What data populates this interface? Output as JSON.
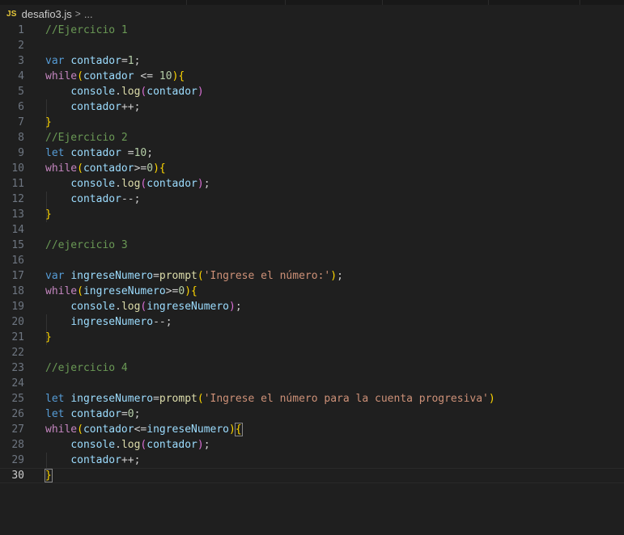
{
  "breadcrumb": {
    "icon_text": "JS",
    "file": "desafio3.js",
    "separator": ">",
    "ellipsis": "..."
  },
  "editor": {
    "current_line": 30,
    "lines": [
      {
        "n": "1",
        "tokens": [
          [
            "cm",
            "//Ejercicio 1"
          ]
        ]
      },
      {
        "n": "2",
        "tokens": []
      },
      {
        "n": "3",
        "tokens": [
          [
            "kw",
            "var"
          ],
          [
            "p",
            " "
          ],
          [
            "var",
            "contador"
          ],
          [
            "p",
            "="
          ],
          [
            "num-lit",
            "1"
          ],
          [
            "p",
            ";"
          ]
        ]
      },
      {
        "n": "4",
        "tokens": [
          [
            "ctl",
            "while"
          ],
          [
            "b1",
            "("
          ],
          [
            "var",
            "contador"
          ],
          [
            "p",
            " <= "
          ],
          [
            "num-lit",
            "10"
          ],
          [
            "b1",
            ")"
          ],
          [
            "b1",
            "{"
          ]
        ]
      },
      {
        "n": "5",
        "tokens": [
          [
            "p",
            "    "
          ],
          [
            "var",
            "console"
          ],
          [
            "p",
            "."
          ],
          [
            "fn",
            "log"
          ],
          [
            "b2",
            "("
          ],
          [
            "var",
            "contador"
          ],
          [
            "b2",
            ")"
          ]
        ]
      },
      {
        "n": "6",
        "tokens": [
          [
            "p",
            "    "
          ],
          [
            "var",
            "contador"
          ],
          [
            "p",
            "++;"
          ]
        ]
      },
      {
        "n": "7",
        "tokens": [
          [
            "b1",
            "}"
          ]
        ]
      },
      {
        "n": "8",
        "tokens": [
          [
            "cm",
            "//Ejercicio 2"
          ]
        ]
      },
      {
        "n": "9",
        "tokens": [
          [
            "kw",
            "let"
          ],
          [
            "p",
            " "
          ],
          [
            "var",
            "contador"
          ],
          [
            "p",
            " ="
          ],
          [
            "num-lit",
            "10"
          ],
          [
            "p",
            ";"
          ]
        ]
      },
      {
        "n": "10",
        "tokens": [
          [
            "ctl",
            "while"
          ],
          [
            "b1",
            "("
          ],
          [
            "var",
            "contador"
          ],
          [
            "p",
            ">="
          ],
          [
            "num-lit",
            "0"
          ],
          [
            "b1",
            ")"
          ],
          [
            "b1",
            "{"
          ]
        ]
      },
      {
        "n": "11",
        "tokens": [
          [
            "p",
            "    "
          ],
          [
            "var",
            "console"
          ],
          [
            "p",
            "."
          ],
          [
            "fn",
            "log"
          ],
          [
            "b2",
            "("
          ],
          [
            "var",
            "contador"
          ],
          [
            "b2",
            ")"
          ],
          [
            "p",
            ";"
          ]
        ]
      },
      {
        "n": "12",
        "tokens": [
          [
            "p",
            "    "
          ],
          [
            "var",
            "contador"
          ],
          [
            "p",
            "--;"
          ]
        ]
      },
      {
        "n": "13",
        "tokens": [
          [
            "b1",
            "}"
          ]
        ]
      },
      {
        "n": "14",
        "tokens": []
      },
      {
        "n": "15",
        "tokens": [
          [
            "cm",
            "//ejercicio 3"
          ]
        ]
      },
      {
        "n": "16",
        "tokens": []
      },
      {
        "n": "17",
        "tokens": [
          [
            "kw",
            "var"
          ],
          [
            "p",
            " "
          ],
          [
            "var",
            "ingreseNumero"
          ],
          [
            "p",
            "="
          ],
          [
            "fn",
            "prompt"
          ],
          [
            "b1",
            "("
          ],
          [
            "str",
            "'Ingrese el número:'"
          ],
          [
            "b1",
            ")"
          ],
          [
            "p",
            ";"
          ]
        ]
      },
      {
        "n": "18",
        "tokens": [
          [
            "ctl",
            "while"
          ],
          [
            "b1",
            "("
          ],
          [
            "var",
            "ingreseNumero"
          ],
          [
            "p",
            ">="
          ],
          [
            "num-lit",
            "0"
          ],
          [
            "b1",
            ")"
          ],
          [
            "b1",
            "{"
          ]
        ]
      },
      {
        "n": "19",
        "tokens": [
          [
            "p",
            "    "
          ],
          [
            "var",
            "console"
          ],
          [
            "p",
            "."
          ],
          [
            "fn",
            "log"
          ],
          [
            "b2",
            "("
          ],
          [
            "var",
            "ingreseNumero"
          ],
          [
            "b2",
            ")"
          ],
          [
            "p",
            ";"
          ]
        ]
      },
      {
        "n": "20",
        "tokens": [
          [
            "p",
            "    "
          ],
          [
            "var",
            "ingreseNumero"
          ],
          [
            "p",
            "--;"
          ]
        ]
      },
      {
        "n": "21",
        "tokens": [
          [
            "b1",
            "}"
          ]
        ]
      },
      {
        "n": "22",
        "tokens": []
      },
      {
        "n": "23",
        "tokens": [
          [
            "cm",
            "//ejercicio 4"
          ]
        ]
      },
      {
        "n": "24",
        "tokens": []
      },
      {
        "n": "25",
        "tokens": [
          [
            "kw",
            "let"
          ],
          [
            "p",
            " "
          ],
          [
            "var",
            "ingreseNumero"
          ],
          [
            "p",
            "="
          ],
          [
            "fn",
            "prompt"
          ],
          [
            "b1",
            "("
          ],
          [
            "str",
            "'Ingrese el número para la cuenta progresiva'"
          ],
          [
            "b1",
            ")"
          ]
        ]
      },
      {
        "n": "26",
        "tokens": [
          [
            "kw",
            "let"
          ],
          [
            "p",
            " "
          ],
          [
            "var",
            "contador"
          ],
          [
            "p",
            "="
          ],
          [
            "num-lit",
            "0"
          ],
          [
            "p",
            ";"
          ]
        ]
      },
      {
        "n": "27",
        "tokens": [
          [
            "ctl",
            "while"
          ],
          [
            "b1",
            "("
          ],
          [
            "var",
            "contador"
          ],
          [
            "p",
            "<="
          ],
          [
            "var",
            "ingreseNumero"
          ],
          [
            "b1",
            ")"
          ],
          [
            "b1-bm",
            "{"
          ]
        ]
      },
      {
        "n": "28",
        "tokens": [
          [
            "p",
            "    "
          ],
          [
            "var",
            "console"
          ],
          [
            "p",
            "."
          ],
          [
            "fn",
            "log"
          ],
          [
            "b2",
            "("
          ],
          [
            "var",
            "contador"
          ],
          [
            "b2",
            ")"
          ],
          [
            "p",
            ";"
          ]
        ]
      },
      {
        "n": "29",
        "tokens": [
          [
            "p",
            "    "
          ],
          [
            "var",
            "contador"
          ],
          [
            "p",
            "++;"
          ]
        ]
      },
      {
        "n": "30",
        "tokens": [
          [
            "b1-bm",
            "}"
          ],
          [
            "cursor",
            ""
          ]
        ]
      }
    ]
  }
}
